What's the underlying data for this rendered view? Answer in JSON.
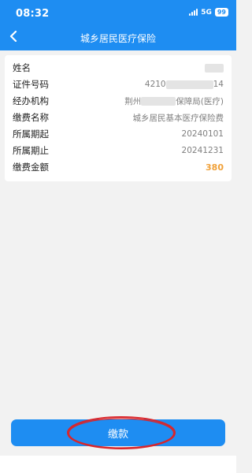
{
  "status_bar": {
    "time": "08:32",
    "network": "5G",
    "battery": "99"
  },
  "header": {
    "title": "城乡居民医疗保险",
    "back_icon": "chevron-left-icon"
  },
  "info": {
    "rows": [
      {
        "label": "姓名",
        "value": ""
      },
      {
        "label": "证件号码",
        "value_prefix": "4210",
        "value_suffix": "14"
      },
      {
        "label": "经办机构",
        "value_prefix": "荆州",
        "value_suffix": "保障局(医疗)"
      },
      {
        "label": "缴费名称",
        "value": "城乡居民基本医疗保险费"
      },
      {
        "label": "所属期起",
        "value": "20240101"
      },
      {
        "label": "所属期止",
        "value": "20241231"
      },
      {
        "label": "缴费金额",
        "value": "380"
      }
    ]
  },
  "actions": {
    "pay_label": "缴款"
  },
  "colors": {
    "primary": "#1e8df2",
    "amount": "#f0a13a",
    "annotation": "#d9252a"
  }
}
